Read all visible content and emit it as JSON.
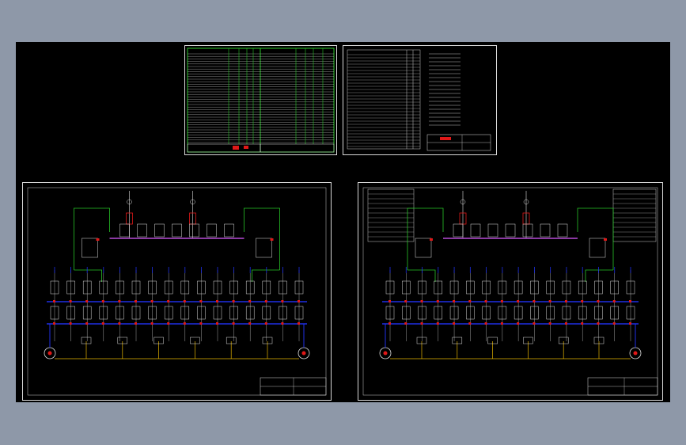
{
  "colors": {
    "background": "#8e98a8",
    "drawing_area": "#000000",
    "frame": "#d8d8d8",
    "busbar": "#1f2fe6",
    "connection": "#27c427",
    "breaker": "#e01818",
    "cable": "#e6b400",
    "text": "#e0e0e0"
  },
  "sheets": [
    {
      "name": "equipment-list-sheet-1",
      "kind": "table"
    },
    {
      "name": "equipment-list-sheet-2",
      "kind": "table-with-notes"
    },
    {
      "name": "single-line-diagram-left",
      "kind": "single-line-diagram"
    },
    {
      "name": "single-line-diagram-right",
      "kind": "single-line-diagram"
    }
  ]
}
